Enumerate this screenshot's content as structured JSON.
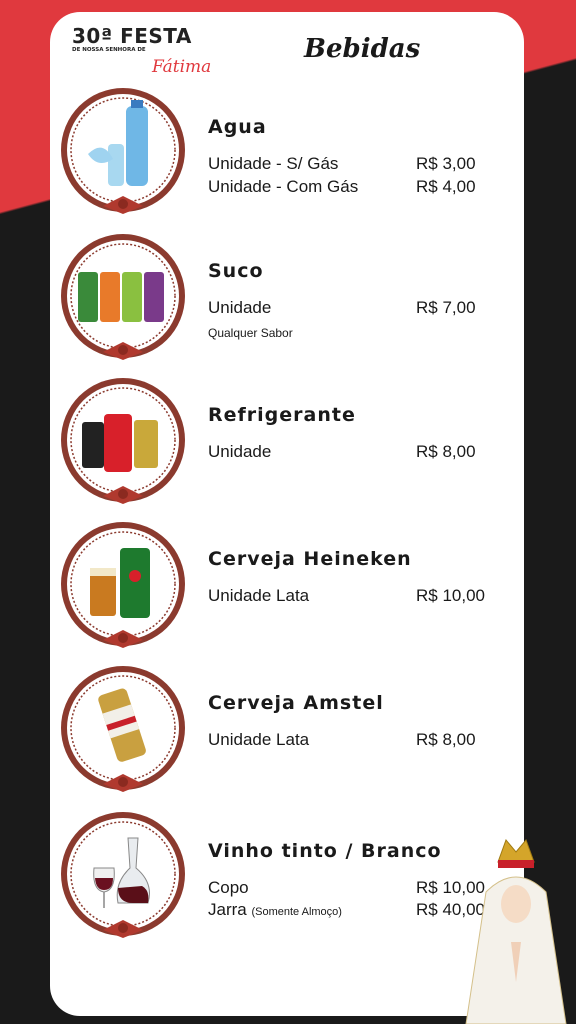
{
  "header": {
    "logo_main": "30ª FESTA",
    "logo_sub": "DE NOSSA SENHORA DE",
    "logo_script": "Fátima",
    "title": "Bebidas"
  },
  "items": [
    {
      "name": "Agua",
      "image": "water-bottle-icon",
      "rows": [
        {
          "label": "Unidade - S/ Gás",
          "price": "R$ 3,00"
        },
        {
          "label": "Unidade - Com Gás",
          "price": "R$ 4,00"
        }
      ]
    },
    {
      "name": "Suco",
      "image": "juice-cans-icon",
      "rows": [
        {
          "label": "Unidade",
          "price": "R$ 7,00"
        }
      ],
      "note": "Qualquer Sabor"
    },
    {
      "name": "Refrigerante",
      "image": "soda-cans-icon",
      "rows": [
        {
          "label": "Unidade",
          "price": "R$ 8,00"
        }
      ]
    },
    {
      "name": "Cerveja Heineken",
      "image": "heineken-can-icon",
      "rows": [
        {
          "label": "Unidade Lata",
          "price": "R$ 10,00"
        }
      ]
    },
    {
      "name": "Cerveja Amstel",
      "image": "amstel-can-icon",
      "rows": [
        {
          "label": "Unidade Lata",
          "price": "R$ 8,00"
        }
      ]
    },
    {
      "name": "Vinho tinto / Branco",
      "image": "wine-glass-icon",
      "rows": [
        {
          "label": "Copo",
          "price": "R$ 10,00"
        },
        {
          "label": "Jarra",
          "note": "(Somente Almoço)",
          "price": "R$ 40,00"
        }
      ]
    }
  ],
  "colors": {
    "accent": "#e0393e",
    "dark": "#1a1a1a",
    "frame": "#8b3a2e",
    "bow": "#b0392e"
  }
}
